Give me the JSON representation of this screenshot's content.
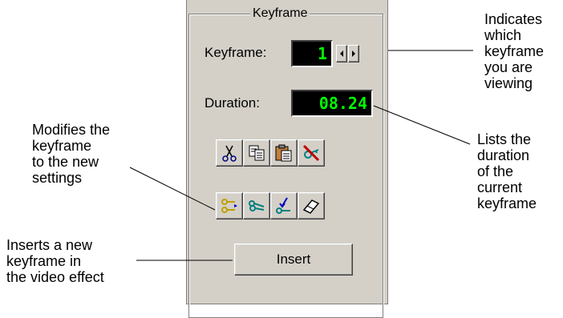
{
  "panel": {
    "group_title": "Keyframe",
    "keyframe_label": "Keyframe:",
    "keyframe_value": "1",
    "duration_label": "Duration:",
    "duration_value": "08.24",
    "insert_label": "Insert",
    "toolbar_row1": [
      "cut-icon",
      "copy-icon",
      "paste-icon",
      "delete-keyframe-icon"
    ],
    "toolbar_row2": [
      "modify-keyframe-icon",
      "keyframes-icon",
      "apply-keyframe-icon",
      "eraser-icon"
    ]
  },
  "annotations": {
    "keyframe_note": [
      "Indicates",
      "which",
      "keyframe",
      "you are",
      "viewing"
    ],
    "duration_note": [
      "Lists the",
      "duration",
      "of the",
      "current",
      "keyframe"
    ],
    "modify_note": [
      "Modifies the",
      "keyframe",
      "to the new",
      "settings"
    ],
    "insert_note": [
      "Inserts a new",
      "keyframe in",
      "the video effect"
    ]
  },
  "colors": {
    "panel_bg": "#d4d0c8",
    "lcd_bg": "#000000",
    "lcd_text": "#00ff00"
  }
}
